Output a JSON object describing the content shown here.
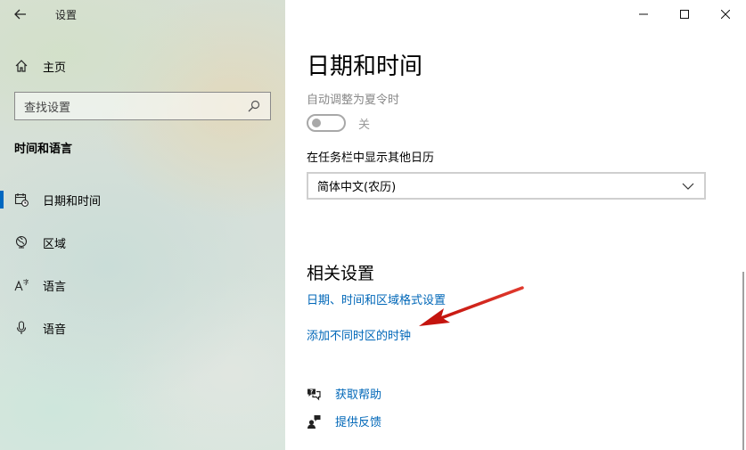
{
  "window": {
    "title": "设置"
  },
  "sidebar": {
    "home_label": "主页",
    "search_placeholder": "查找设置",
    "section_title": "时间和语言",
    "items": [
      {
        "label": "日期和时间",
        "icon": "calendar-clock-icon",
        "selected": true
      },
      {
        "label": "区域",
        "icon": "globe-icon",
        "selected": false
      },
      {
        "label": "语言",
        "icon": "language-icon",
        "selected": false
      },
      {
        "label": "语音",
        "icon": "microphone-icon",
        "selected": false
      }
    ]
  },
  "main": {
    "page_title": "日期和时间",
    "dst": {
      "label": "自动调整为夏令时",
      "state": "关",
      "on": false
    },
    "taskbar_calendar": {
      "label": "在任务栏中显示其他日历",
      "selected": "简体中文(农历)"
    },
    "related": {
      "title": "相关设置",
      "links": [
        "日期、时间和区域格式设置",
        "添加不同时区的时钟"
      ]
    },
    "help": {
      "get_help": "获取帮助",
      "feedback": "提供反馈"
    }
  },
  "colors": {
    "accent": "#0067c0",
    "link": "#0067b8",
    "annotation_arrow": "#d0201c"
  }
}
